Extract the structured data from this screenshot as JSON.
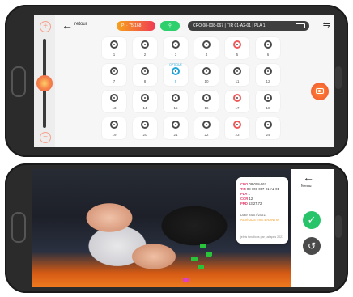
{
  "top_screen": {
    "header": {
      "back_label": "retour",
      "orange_pill": "P:  · 75.168",
      "dark_pill": "CRO 08-008-067  |  TIR 01-A2-01  |  PLA 1"
    },
    "ports": [
      {
        "label": "1",
        "state": "normal"
      },
      {
        "label": "2",
        "state": "normal"
      },
      {
        "label": "3",
        "state": "normal"
      },
      {
        "label": "4",
        "state": "normal"
      },
      {
        "label": "5",
        "state": "highlight"
      },
      {
        "label": "6",
        "state": "normal"
      },
      {
        "label": "7",
        "state": "normal"
      },
      {
        "label": "8",
        "state": "normal"
      },
      {
        "label": "9",
        "state": "selected",
        "tag": "OPTIQUE"
      },
      {
        "label": "10",
        "state": "normal"
      },
      {
        "label": "11",
        "state": "normal"
      },
      {
        "label": "12",
        "state": "normal"
      },
      {
        "label": "13",
        "state": "normal"
      },
      {
        "label": "14",
        "state": "normal"
      },
      {
        "label": "15",
        "state": "normal"
      },
      {
        "label": "16",
        "state": "normal"
      },
      {
        "label": "17",
        "state": "highlight"
      },
      {
        "label": "18",
        "state": "normal"
      },
      {
        "label": "19",
        "state": "normal"
      },
      {
        "label": "20",
        "state": "normal"
      },
      {
        "label": "21",
        "state": "normal"
      },
      {
        "label": "22",
        "state": "normal"
      },
      {
        "label": "23",
        "state": "highlight"
      },
      {
        "label": "24",
        "state": "normal"
      }
    ],
    "colors": {
      "accent_orange": "#f7a21b",
      "accent_red": "#ef3a54",
      "green": "#2ed06e",
      "selected": "#20a6d8"
    }
  },
  "bottom_screen": {
    "info": {
      "cro_key": "CRO",
      "cro_val": "08-008-067",
      "tir_key": "TIR",
      "tir_val": "08-008-067-01-A2-01",
      "pla_key": "PLA",
      "pla_val": "1",
      "cor_key": "COR",
      "cor_val": "12",
      "prd_key": "PRD",
      "prd_val": "53.27.72",
      "date_line": "Date 28/07/2021",
      "user_line": "Acné JOSTINE BRANTIN",
      "footer": "jelnis fonctions par justapris 2021"
    },
    "side": {
      "menu_label": "Menu"
    },
    "colors": {
      "ok": "#27c46a",
      "undo": "#4a4a4a",
      "key": "#e23b6a"
    }
  }
}
